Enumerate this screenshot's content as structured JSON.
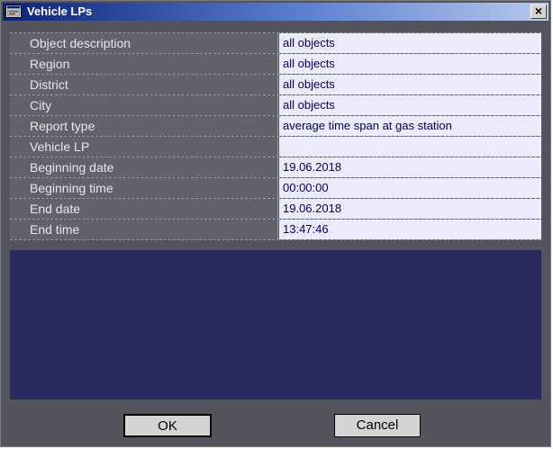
{
  "window": {
    "title": "Vehicle LPs",
    "close_label": "×"
  },
  "rows": [
    {
      "label": "Object description",
      "value": "all objects"
    },
    {
      "label": "Region",
      "value": "all objects"
    },
    {
      "label": "District",
      "value": "all objects"
    },
    {
      "label": "City",
      "value": "all objects"
    },
    {
      "label": "Report type",
      "value": "average time span at gas station"
    },
    {
      "label": "Vehicle LP",
      "value": ""
    },
    {
      "label": "Beginning date",
      "value": "19.06.2018"
    },
    {
      "label": "Beginning time",
      "value": "00:00:00"
    },
    {
      "label": "End date",
      "value": "19.06.2018"
    },
    {
      "label": "End time",
      "value": "13:47:46"
    }
  ],
  "buttons": {
    "ok_label": "OK",
    "cancel_label": "Cancel"
  },
  "icons": {
    "title_icon": "window-app-icon",
    "close": "close-icon"
  }
}
